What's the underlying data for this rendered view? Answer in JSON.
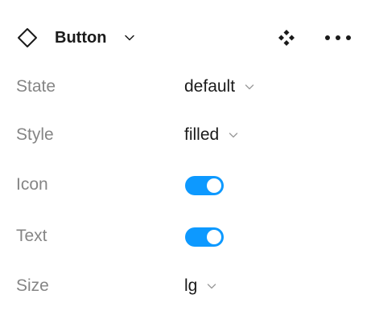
{
  "header": {
    "title": "Button",
    "component_icon": "component-diamond-icon",
    "title_chevron_icon": "chevron-down-icon",
    "instance_icon": "instance-diamonds-icon",
    "more_icon": "more-horizontal-icon"
  },
  "properties": [
    {
      "label": "State",
      "type": "dropdown",
      "value": "default"
    },
    {
      "label": "Style",
      "type": "dropdown",
      "value": "filled"
    },
    {
      "label": "Icon",
      "type": "toggle",
      "checked": true
    },
    {
      "label": "Text",
      "type": "toggle",
      "checked": true
    },
    {
      "label": "Size",
      "type": "dropdown",
      "value": "lg"
    }
  ],
  "colors": {
    "toggle_on": "#0d99ff",
    "label": "#858585",
    "text": "#1a1a1a"
  }
}
